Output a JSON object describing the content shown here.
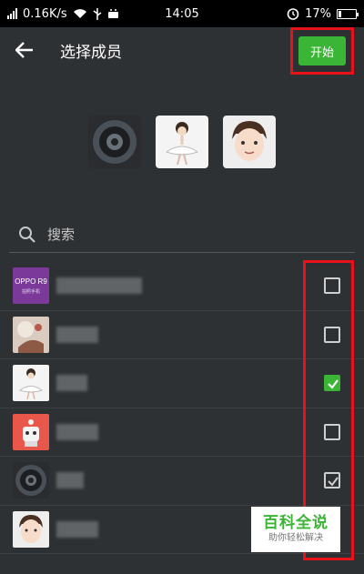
{
  "status_bar": {
    "network_speed": "0.16K/s",
    "time": "14:05",
    "battery": "17%",
    "battery_level": 0.17
  },
  "header": {
    "back_icon": "arrow-left-icon",
    "title": "选择成员",
    "start_label": "开始"
  },
  "selected_members": [
    {
      "avatar": "speaker-photo"
    },
    {
      "avatar": "ballerina-cartoon"
    },
    {
      "avatar": "boy-cartoon"
    }
  ],
  "search": {
    "placeholder": "搜索"
  },
  "contacts": [
    {
      "avatar": "oppo-r9-logo",
      "avatar_text": "OPPO R9",
      "avatar_subtext": "拍照手机",
      "checked": false,
      "check_style": "none"
    },
    {
      "avatar": "illustration-photo",
      "checked": false,
      "check_style": "none"
    },
    {
      "avatar": "ballerina-cartoon",
      "checked": true,
      "check_style": "green"
    },
    {
      "avatar": "robot-cartoon",
      "checked": false,
      "check_style": "none"
    },
    {
      "avatar": "speaker-photo",
      "checked": true,
      "check_style": "grey"
    },
    {
      "avatar": "boy-cartoon",
      "checked": false,
      "check_style": "none"
    }
  ],
  "watermark": {
    "main": "百科全说",
    "sub": "助你轻松解决"
  },
  "colors": {
    "background": "#2e3134",
    "accent_green": "#3bb536",
    "highlight_red": "#e8121a"
  }
}
